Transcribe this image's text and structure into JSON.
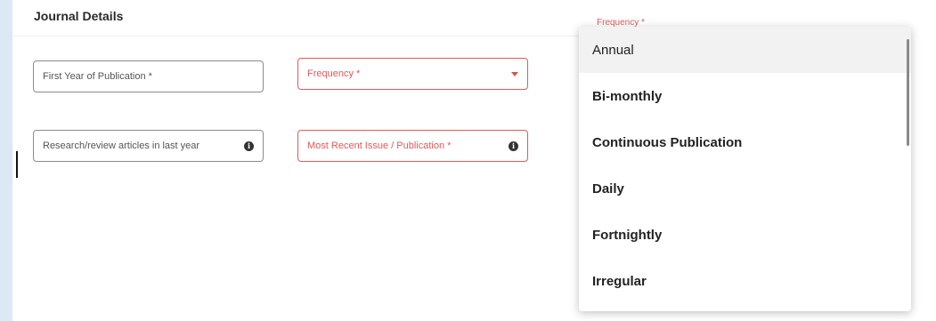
{
  "section": {
    "title": "Journal Details"
  },
  "fields": {
    "first_year": {
      "label": "First Year of Publication *"
    },
    "frequency": {
      "label": "Frequency *"
    },
    "articles": {
      "label": "Research/review articles in last year"
    },
    "recent_issue": {
      "label": "Most Recent Issue / Publication *"
    }
  },
  "dropdown": {
    "float_label": "Frequency *",
    "options": [
      {
        "label": "Annual",
        "highlighted": true
      },
      {
        "label": "Bi-monthly"
      },
      {
        "label": "Continuous Publication"
      },
      {
        "label": "Daily"
      },
      {
        "label": "Fortnightly"
      },
      {
        "label": "Irregular"
      }
    ]
  },
  "icons": {
    "info": "info-icon",
    "caret": "chevron-down-icon"
  },
  "colors": {
    "error": "#e05a5a",
    "page_background": "#dce8f3",
    "highlight": "#f2f2f2"
  }
}
